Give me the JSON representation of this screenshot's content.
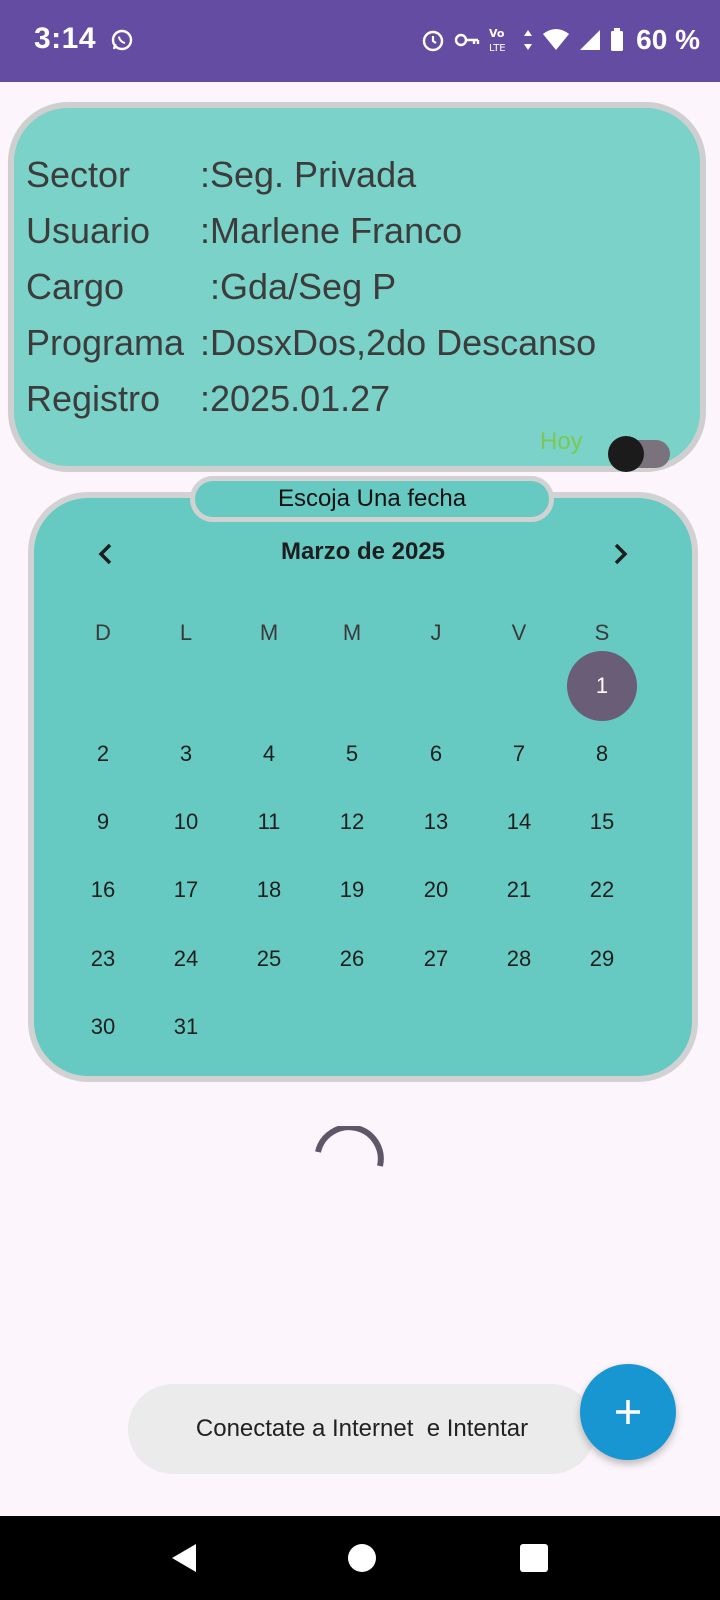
{
  "status_bar": {
    "time": "3:14",
    "battery": "60 %",
    "icons": [
      "whatsapp-icon",
      "alarm-icon",
      "vpn-key-icon",
      "volte-lte-icon",
      "data-arrows-icon",
      "wifi-icon",
      "signal-icon",
      "battery-icon"
    ],
    "color": "#644ca2"
  },
  "info_card": {
    "rows": [
      {
        "label": "Sector",
        "value": ":Seg. Privada"
      },
      {
        "label": "Usuario",
        "value": ":Marlene Franco"
      },
      {
        "label": "Cargo",
        "value": ":Gda/Seg P"
      },
      {
        "label": "Programa",
        "value": ":DosxDos,2do Descanso"
      },
      {
        "label": "Registro",
        "value": ":2025.01.27"
      }
    ],
    "toggle_label": "Hoy",
    "toggle_on": false,
    "color": "#7ad2c8"
  },
  "calendar": {
    "header_pill": "Escoja Una fecha",
    "month_title": "Marzo de 2025",
    "weekdays": [
      "D",
      "L",
      "M",
      "M",
      "J",
      "V",
      "S"
    ],
    "selected_day": "1",
    "days": [
      "1",
      "2",
      "3",
      "4",
      "5",
      "6",
      "7",
      "8",
      "9",
      "10",
      "11",
      "12",
      "13",
      "14",
      "15",
      "16",
      "17",
      "18",
      "19",
      "20",
      "21",
      "22",
      "23",
      "24",
      "25",
      "26",
      "27",
      "28",
      "29",
      "30",
      "31"
    ],
    "first_weekday_index": 6,
    "color": "#67cac2"
  },
  "snackbar": {
    "message": "Conectate a Internet  e Intentar"
  },
  "fab": {
    "icon": "plus-icon",
    "color": "#1796d2"
  }
}
